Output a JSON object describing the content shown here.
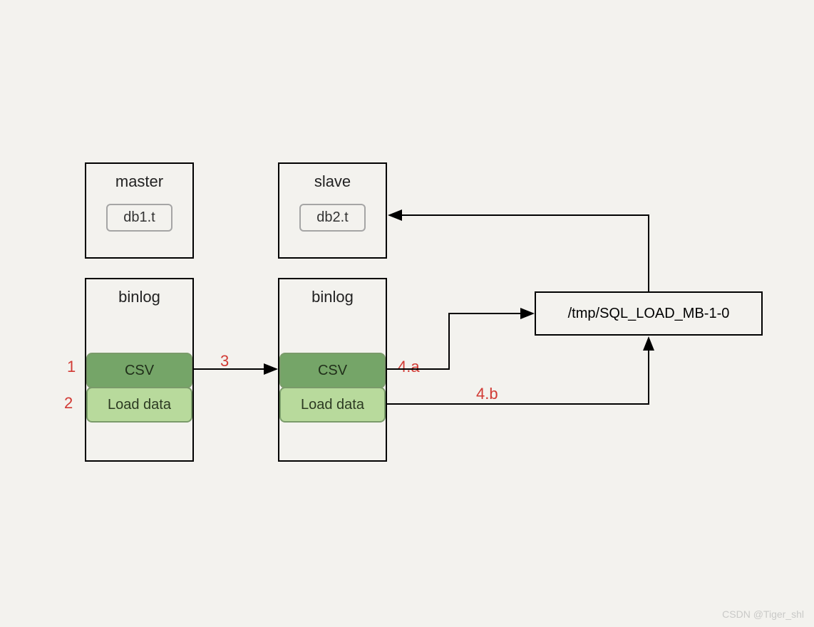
{
  "master": {
    "title": "master",
    "db": "db1.t"
  },
  "slave": {
    "title": "slave",
    "db": "db2.t"
  },
  "binlog_master": {
    "title": "binlog",
    "csv": "CSV",
    "load": "Load data"
  },
  "binlog_slave": {
    "title": "binlog",
    "csv": "CSV",
    "load": "Load data"
  },
  "tmp": "/tmp/SQL_LOAD_MB-1-0",
  "labels": {
    "l1": "1",
    "l2": "2",
    "l3": "3",
    "l4a": "4.a",
    "l4b": "4.b"
  },
  "watermark": "CSDN @Tiger_shl",
  "colors": {
    "csv": "#75a568",
    "load": "#b8da9c",
    "red": "#d13a34",
    "bg": "#f3f2ee"
  }
}
